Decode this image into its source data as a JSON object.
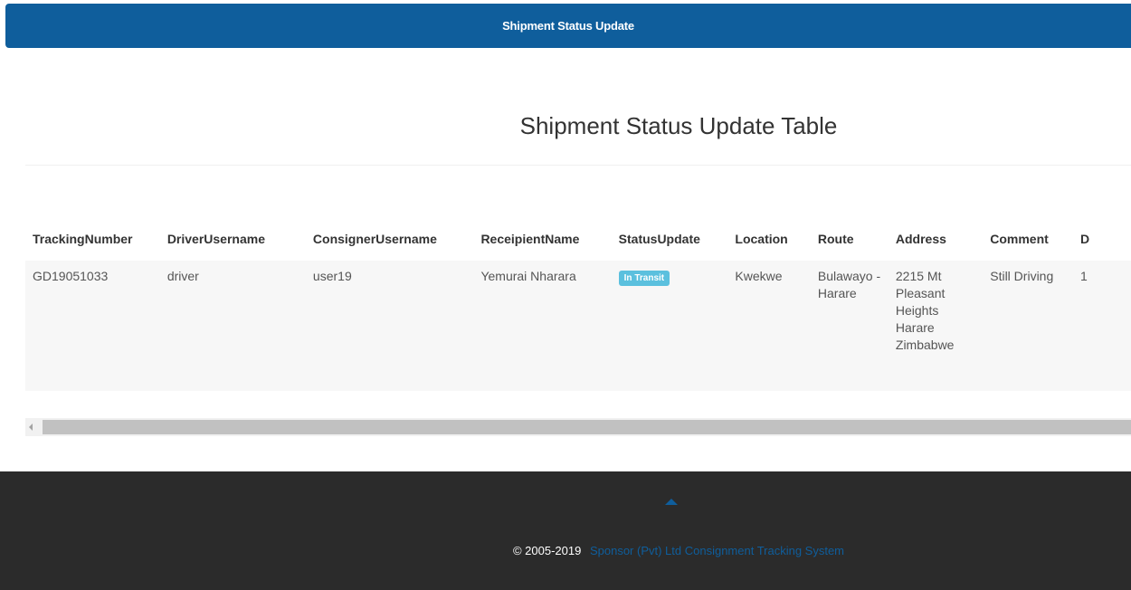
{
  "header": {
    "title": "Shipment Status Update"
  },
  "page": {
    "title": "Shipment Status Update Table"
  },
  "table": {
    "columns": [
      "TrackingNumber",
      "DriverUsername",
      "ConsignerUsername",
      "ReceipientName",
      "StatusUpdate",
      "Location",
      "Route",
      "Address",
      "Comment",
      "D"
    ],
    "rows": [
      {
        "tracking_number": "GD19051033",
        "driver_username": "driver",
        "consigner_username": "user19",
        "recipient_name": "Yemurai Nharara",
        "status_update": "In Transit",
        "location": "Kwekwe",
        "route": "Bulawayo - Harare",
        "address": "2215 Mt Pleasant Heights Harare Zimbabwe",
        "comment": "Still Driving",
        "d": "1"
      }
    ]
  },
  "footer": {
    "copyright": "© 2005-2019",
    "link_text": "Sponsor (Pvt) Ltd Consignment Tracking System"
  },
  "colors": {
    "brand": "#0f5e9c",
    "footer_bg": "#2b2b2b",
    "badge_info": "#5bc0de"
  }
}
